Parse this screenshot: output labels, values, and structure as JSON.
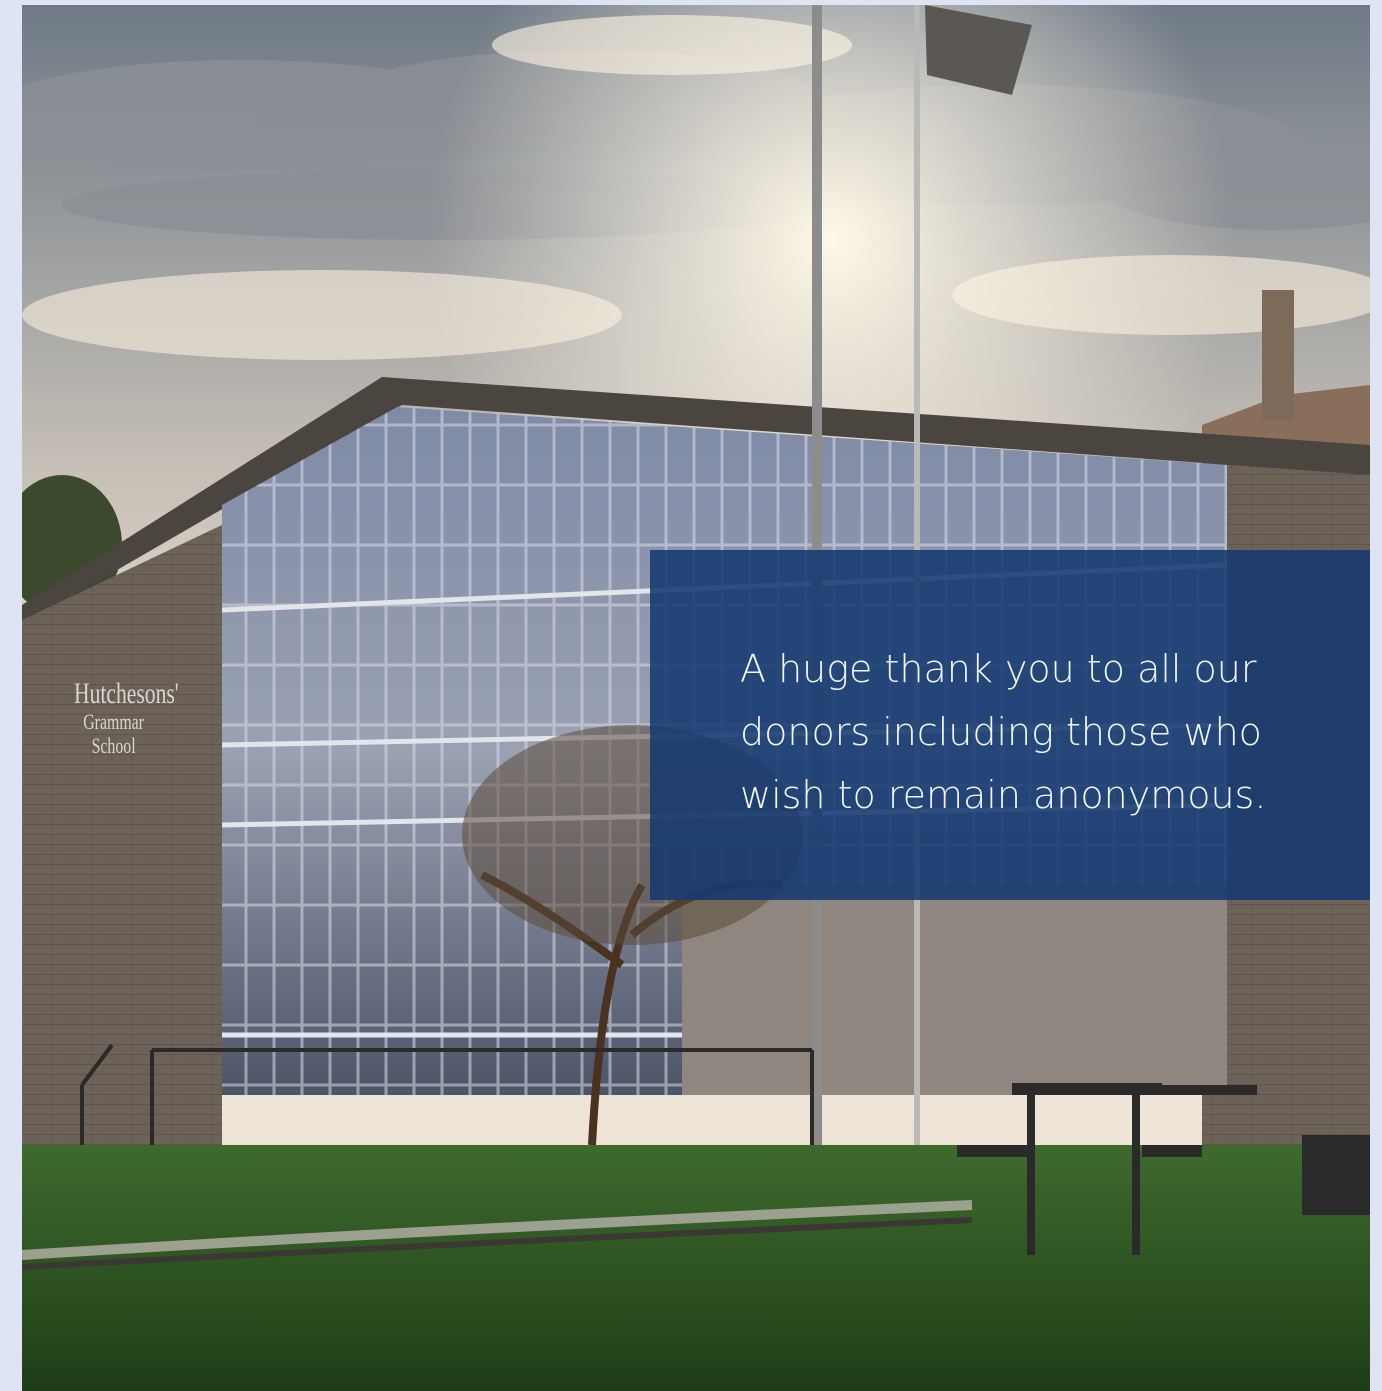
{
  "image": {
    "alt": "",
    "sign_line_1": "Hutchesons'",
    "sign_line_2": "Grammar School"
  },
  "overlay": {
    "message": "A huge thank you to all our donors including those who wish to remain anonymous.",
    "background_color": "#153970",
    "text_color": "#f3f5fa"
  },
  "page": {
    "background_color": "#dfe4f4"
  }
}
